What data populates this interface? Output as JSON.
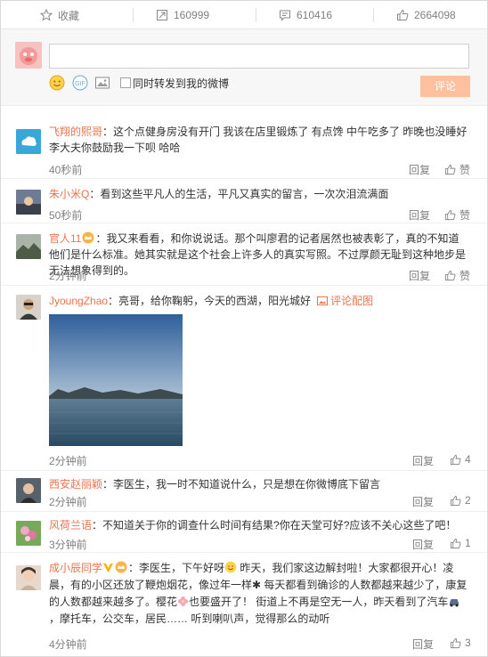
{
  "actions": {
    "favorite_label": "收藏",
    "forward_count": "160999",
    "comment_count": "610416",
    "like_count": "2664098"
  },
  "composer": {
    "input_value": "",
    "forward_label": "同时转发到我的微博",
    "post_label": "评论"
  },
  "labels": {
    "reply": "回复",
    "like": "赞"
  },
  "comments": [
    {
      "user": "飞翔的熙哥",
      "text": "：这个点健身房没有开门 我该在店里锻炼了 有点馋 中午吃多了 昨晚也没睡好 李大夫你鼓励我一下呗 哈哈",
      "time": "40秒前",
      "likes": "赞"
    },
    {
      "user": "朱小米Q",
      "text": "：看到这些平凡人的生活，平凡又真实的留言，一次次泪流满面",
      "time": "50秒前",
      "likes": "赞"
    },
    {
      "user": "官人11",
      "text": "：我又来看看，和你说说话。那个叫廖君的记者居然也被表彰了，真的不知道他们是什么标准。她其实就是这个社会上许多人的真实写照。不过厚颜无耻到这种地步是无法想象得到的。",
      "time": "2分钟前",
      "likes": "赞"
    },
    {
      "user": "JyoungZhao",
      "text": "：亮哥，给你鞠躬，今天的西湖，阳光城好",
      "photo_label": "评论配图",
      "time": "2分钟前",
      "likes": "4"
    },
    {
      "user": "西安赵丽颖",
      "text": "：李医生，我一时不知道说什么，只是想在你微博底下留言",
      "time": "2分钟前",
      "likes": "2"
    },
    {
      "user": "风荷兰语",
      "text": "：不知道关于你的调查什么时间有结果?你在天堂可好?应该不关心这些了吧！",
      "time": "3分钟前",
      "likes": "1"
    },
    {
      "user": "成小辰同学",
      "text_a": "：李医生，下午好呀",
      "text_b": " 昨天，我们家这边解封啦！大家都很开心！凌晨，有的小区还放了鞭炮烟花，像过年一样✱ 每天都看到确诊的人数都越来越少了，康复的人数都越来越多了。樱花",
      "text_c": "也要盛开了！ 街道上不再是空无一人，昨天看到了汽车",
      "text_d": "，摩托车，公交车，居民…… 听到喇叭声，觉得那么的动听",
      "time": "4分钟前",
      "likes": "3"
    }
  ],
  "colors": {
    "username": "#eb7350",
    "post_button": "#ffc09f",
    "meta_gray": "#808080"
  }
}
